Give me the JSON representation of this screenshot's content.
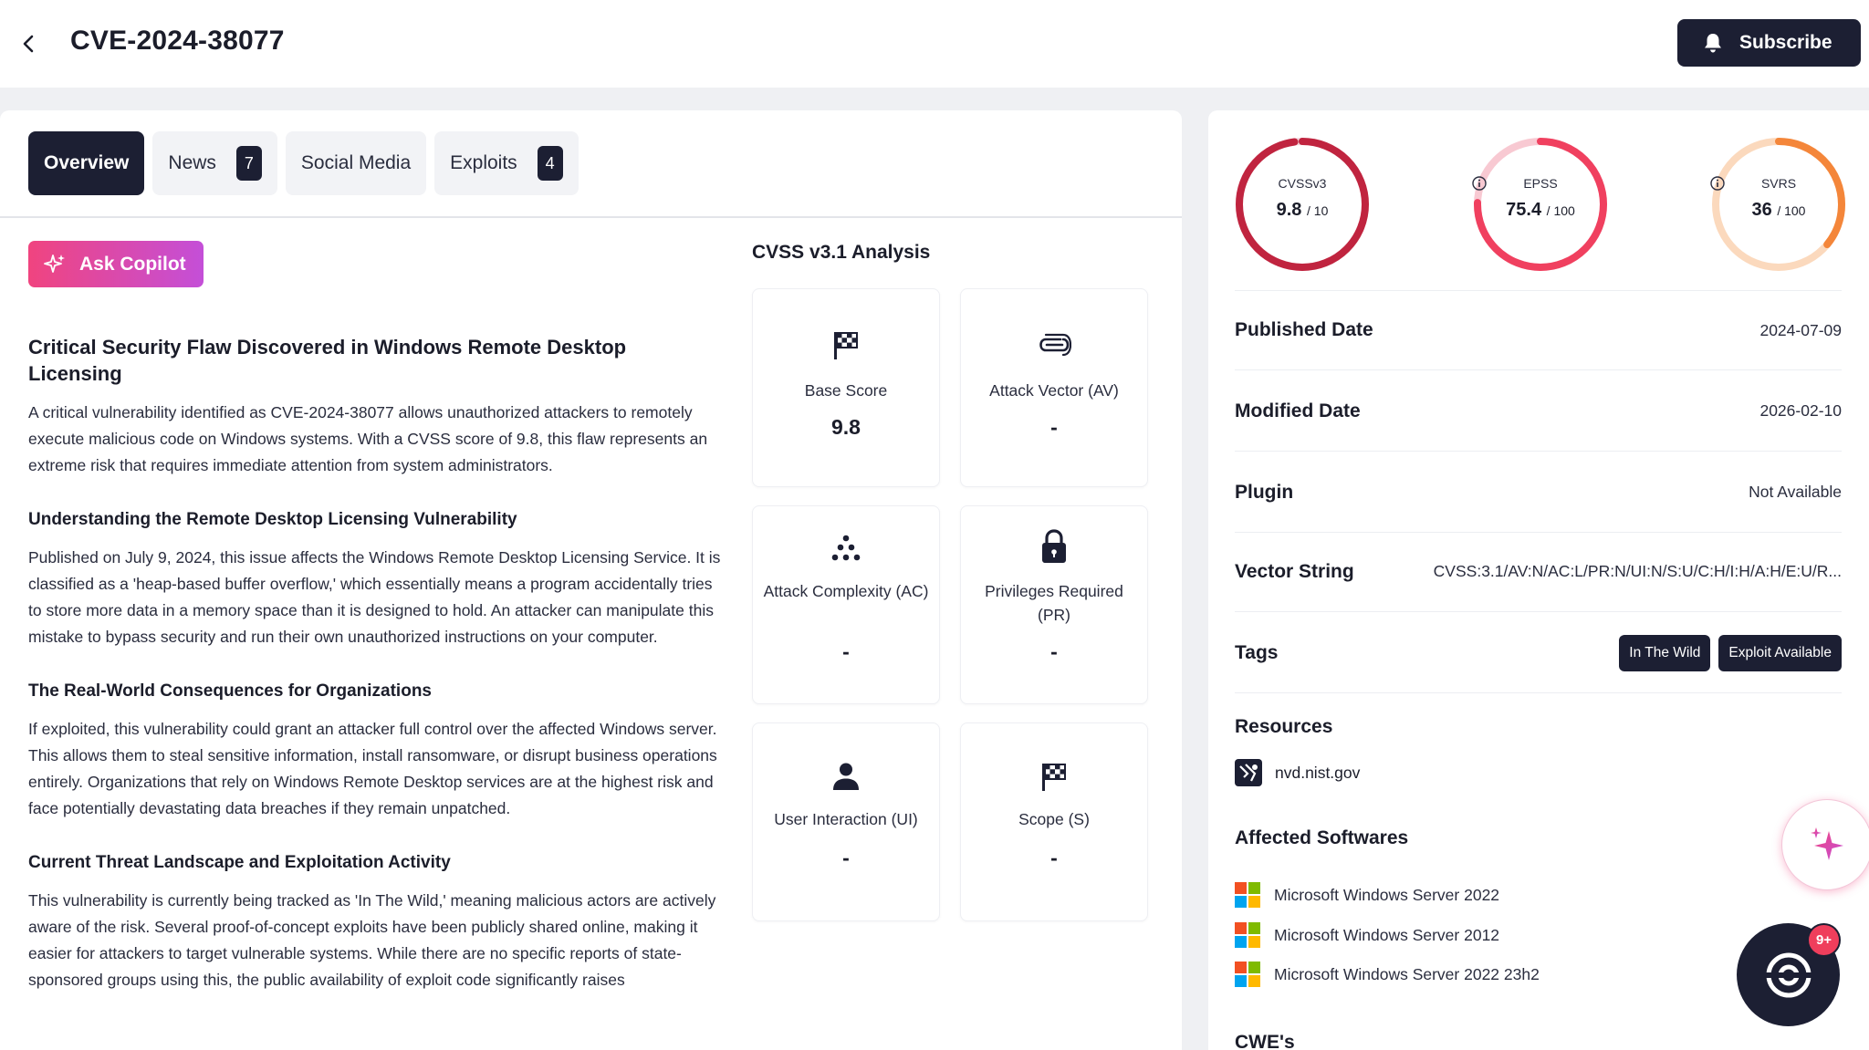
{
  "header": {
    "title": "CVE-2024-38077",
    "subscribe_label": "Subscribe"
  },
  "tabs": [
    {
      "label": "Overview",
      "count": null,
      "active": true
    },
    {
      "label": "News",
      "count": "7"
    },
    {
      "label": "Social Media",
      "count": null
    },
    {
      "label": "Exploits",
      "count": "4"
    }
  ],
  "copilot_label": "Ask Copilot",
  "article": {
    "title": "Critical Security Flaw Discovered in Windows Remote Desktop Licensing",
    "intro": "A critical vulnerability identified as CVE-2024-38077 allows unauthorized attackers to remotely execute malicious code on Windows systems. With a CVSS score of 9.8, this flaw represents an extreme risk that requires immediate attention from system administrators.",
    "sections": [
      {
        "heading": "Understanding the Remote Desktop Licensing Vulnerability",
        "body": "Published on July 9, 2024, this issue affects the Windows Remote Desktop Licensing Service. It is classified as a 'heap-based buffer overflow,' which essentially means a program accidentally tries to store more data in a memory space than it is designed to hold. An attacker can manipulate this mistake to bypass security and run their own unauthorized instructions on your computer."
      },
      {
        "heading": "The Real-World Consequences for Organizations",
        "body": "If exploited, this vulnerability could grant an attacker full control over the affected Windows server. This allows them to steal sensitive information, install ransomware, or disrupt business operations entirely. Organizations that rely on Windows Remote Desktop services are at the highest risk and face potentially devastating data breaches if they remain unpatched."
      },
      {
        "heading": "Current Threat Landscape and Exploitation Activity",
        "body": "This vulnerability is currently being tracked as 'In The Wild,' meaning malicious actors are actively aware of the risk. Several proof-of-concept exploits have been publicly shared online, making it easier for attackers to target vulnerable systems. While there are no specific reports of state-sponsored groups using this, the public availability of exploit code significantly raises"
      }
    ]
  },
  "cvss": {
    "title": "CVSS v3.1 Analysis",
    "metrics": [
      {
        "label": "Base Score",
        "value": "9.8",
        "icon": "checkered-flag-icon"
      },
      {
        "label": "Attack Vector (AV)",
        "value": "-",
        "icon": "paperclip-icon"
      },
      {
        "label": "Attack Complexity (AC)",
        "value": "-",
        "icon": "dots-pyramid-icon"
      },
      {
        "label": "Privileges Required (PR)",
        "value": "-",
        "icon": "lock-icon"
      },
      {
        "label": "User Interaction (UI)",
        "value": "-",
        "icon": "user-icon"
      },
      {
        "label": "Scope (S)",
        "value": "-",
        "icon": "checkered-flag-icon"
      }
    ]
  },
  "scores": [
    {
      "name": "CVSSv3",
      "value": "9.8",
      "max": "/ 10",
      "fraction": 0.98,
      "color": "#c0243f",
      "track": "#f3d3da",
      "info": false
    },
    {
      "name": "EPSS",
      "value": "75.4",
      "max": "/ 100",
      "fraction": 0.754,
      "color": "#f0405f",
      "track": "#f8c9d2",
      "info": true
    },
    {
      "name": "SVRS",
      "value": "36",
      "max": "/ 100",
      "fraction": 0.36,
      "color": "#f4863a",
      "track": "#fbd9bd",
      "info": true
    }
  ],
  "details": {
    "published_label": "Published Date",
    "published_value": "2024-07-09",
    "modified_label": "Modified Date",
    "modified_value": "2026-02-10",
    "plugin_label": "Plugin",
    "plugin_value": "Not Available",
    "vector_label": "Vector String",
    "vector_value": "CVSS:3.1/AV:N/AC:L/PR:N/UI:N/S:U/C:H/I:H/A:H/E:U/R...",
    "tags_label": "Tags",
    "tags": [
      "In The Wild",
      "Exploit Available"
    ]
  },
  "resources": {
    "heading": "Resources",
    "items": [
      {
        "label": "nvd.nist.gov"
      }
    ]
  },
  "affected": {
    "heading": "Affected Softwares",
    "items": [
      "Microsoft Windows Server 2022",
      "Microsoft Windows Server 2012",
      "Microsoft Windows Server 2022 23h2"
    ]
  },
  "cwe_heading": "CWE's",
  "chat_badge": "9+",
  "colors": {
    "dark": "#1c1f33",
    "accent_pink": "#f0447f",
    "accent_purple": "#c44fd8"
  }
}
